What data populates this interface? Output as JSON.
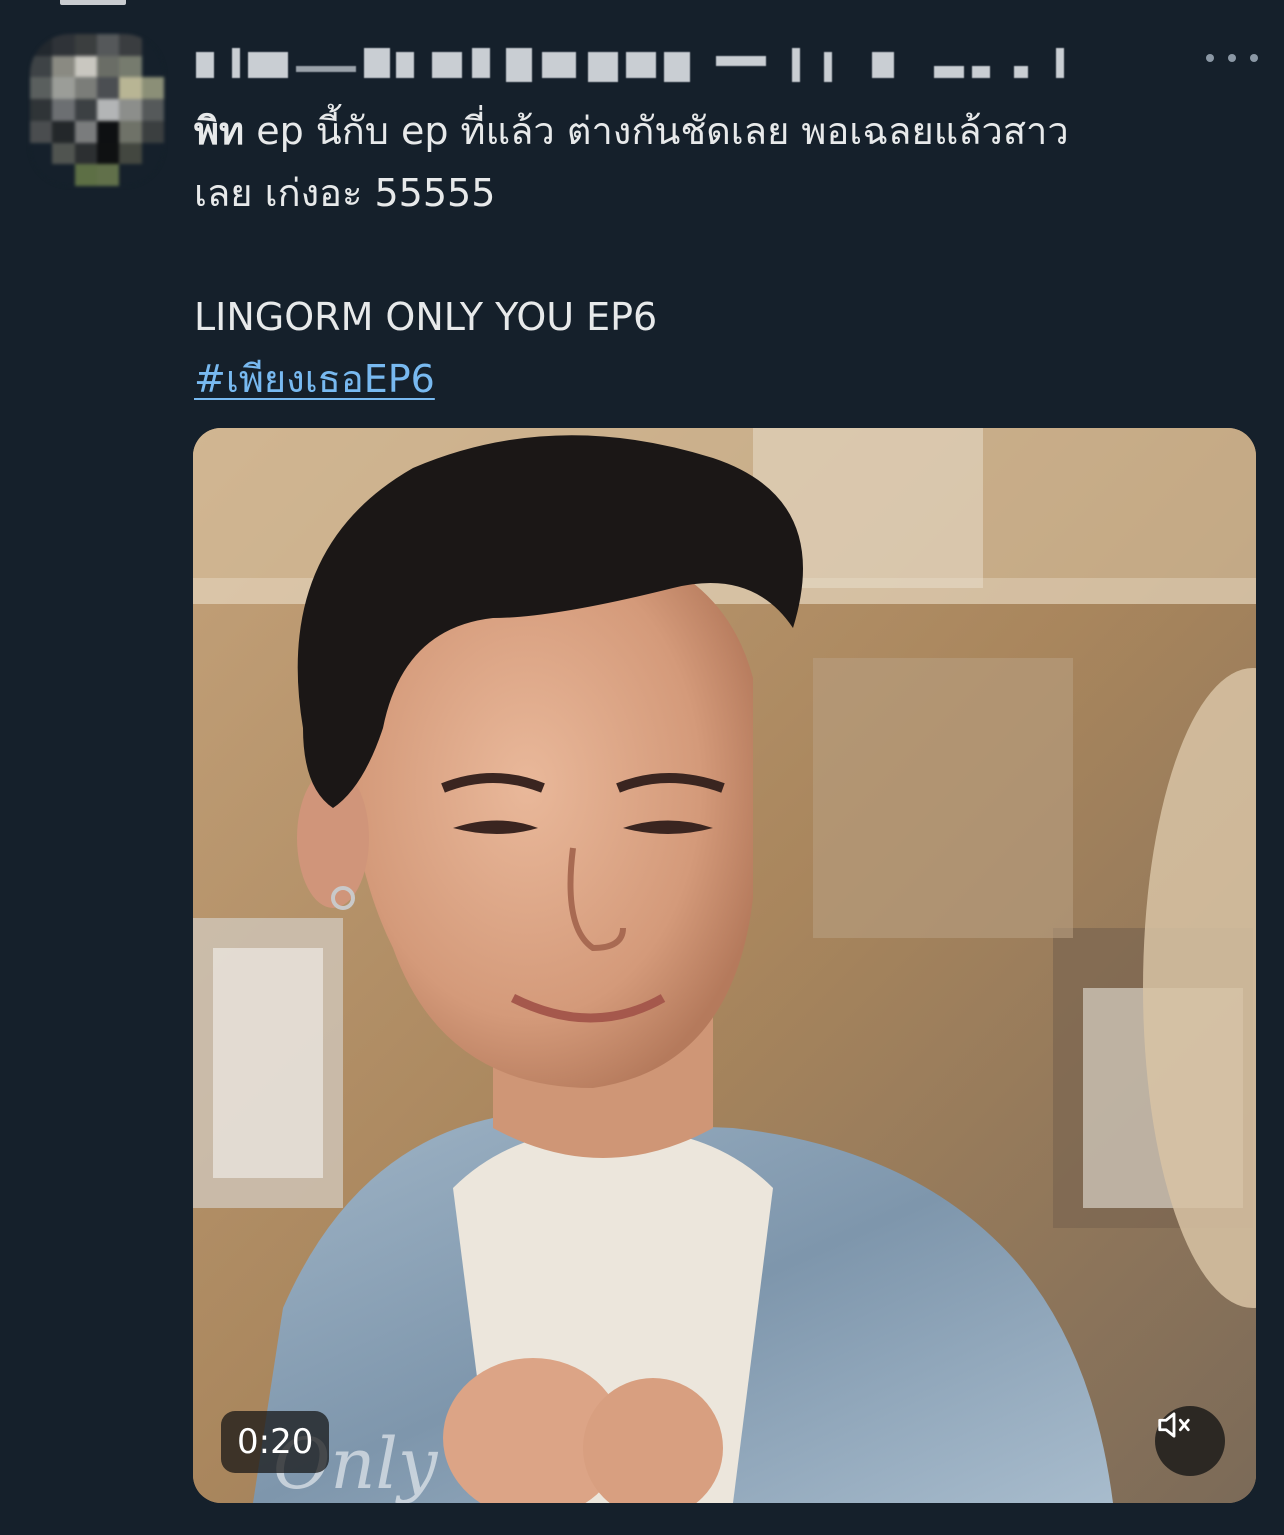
{
  "tweet": {
    "text_bold": "พิท",
    "text_line1_rest": " ep นี้กับ ep ที่แล้ว ต่างกันชัดเลย พอเฉลยแล้วสาว",
    "text_line2": "เลย เก่งอะ 55555",
    "text_line3": "LINGORM ONLY YOU EP6",
    "hashtag": "#เพียงเธอEP6"
  },
  "media": {
    "timestamp": "0:20",
    "watermark": "Only"
  },
  "icons": {
    "more": "more-horizontal-icon",
    "mute": "volume-muted-icon"
  },
  "colors": {
    "background": "#15202b",
    "text": "#e7e9ea",
    "link": "#78b9f0",
    "muted": "#8b98a5"
  }
}
